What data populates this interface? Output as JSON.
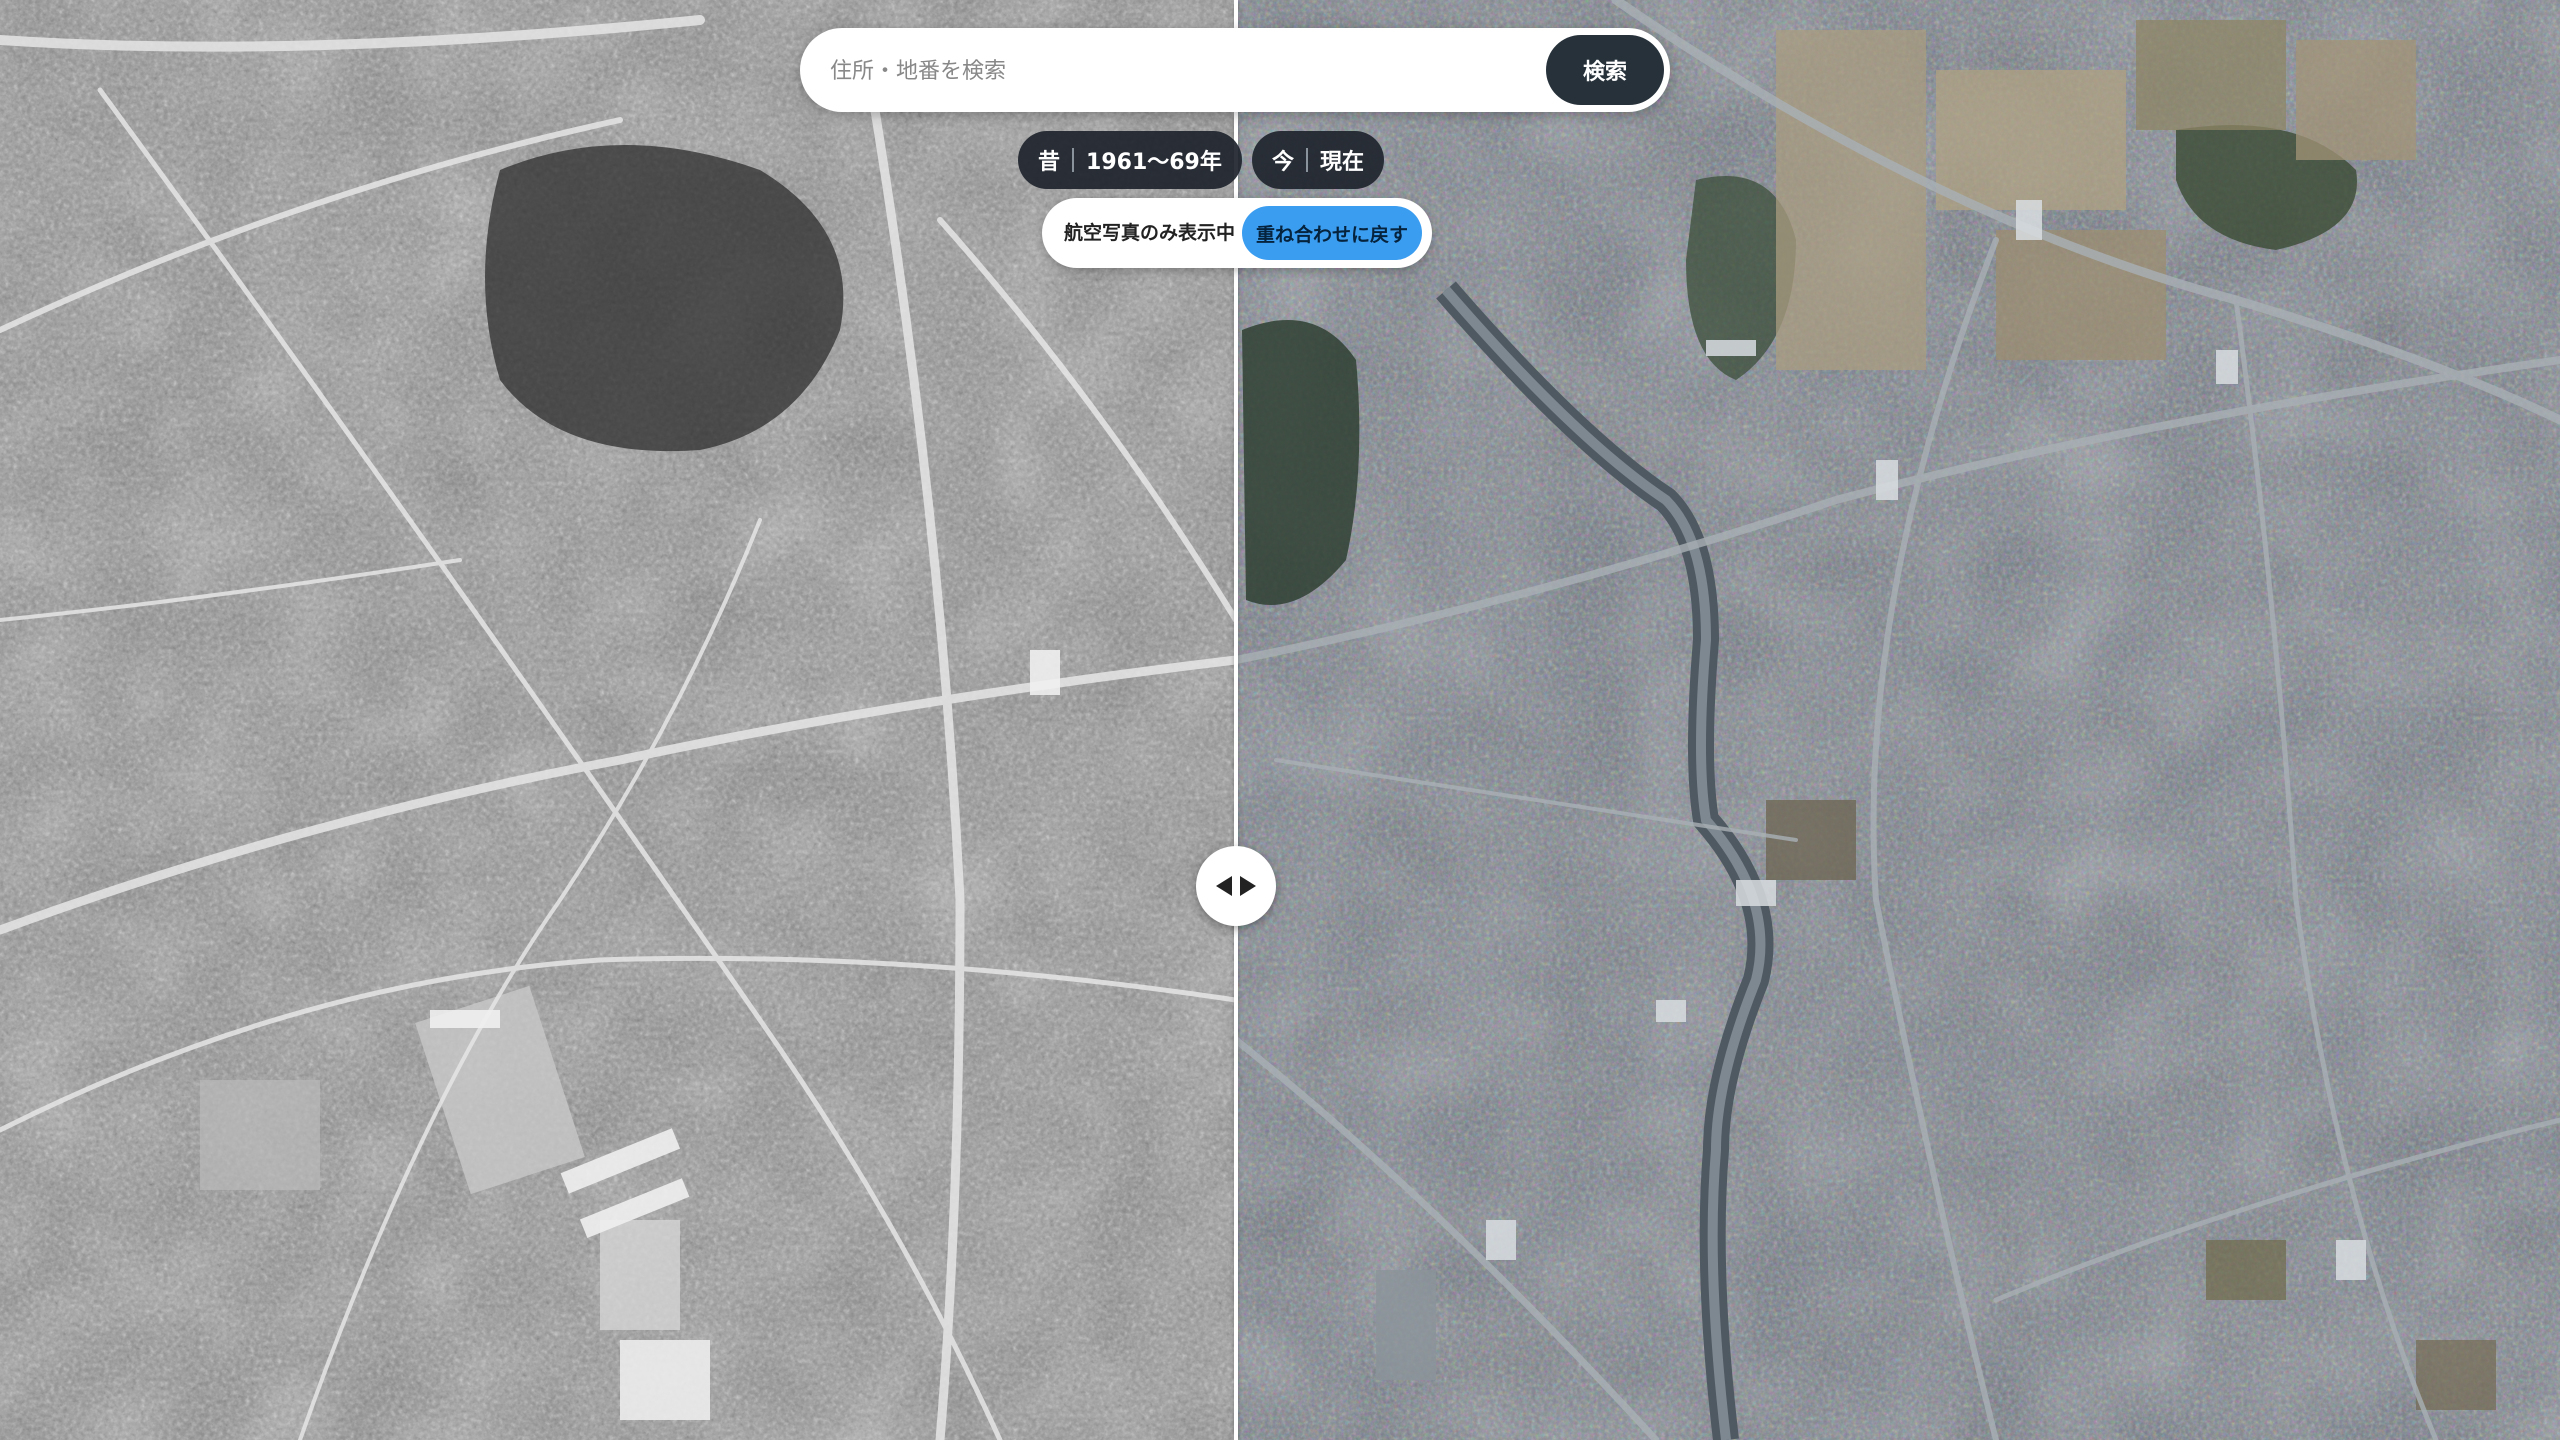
{
  "search": {
    "placeholder": "住所・地番を検索",
    "button_label": "検索"
  },
  "eras": {
    "old": {
      "label": "昔",
      "years": "1961〜69年"
    },
    "new": {
      "label": "今",
      "years": "現在"
    }
  },
  "mode": {
    "status": "航空写真のみ表示中",
    "button_label": "重ね合わせに戻す"
  },
  "colors": {
    "accent": "#3b9df0",
    "dark_pill": "#1e242c",
    "search_button": "#26313a"
  },
  "icons": {
    "slider": "left-right-arrows-icon"
  }
}
